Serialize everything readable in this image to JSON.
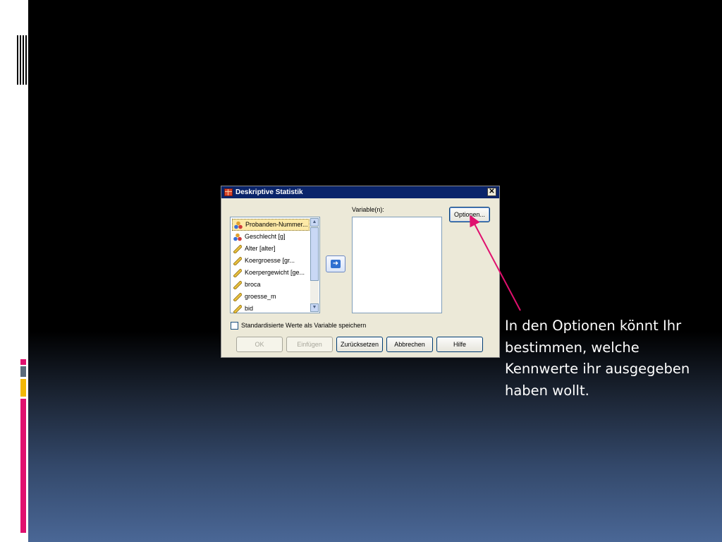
{
  "dialog": {
    "title": "Deskriptive Statistik",
    "close_label": "✕",
    "source_variables": [
      {
        "label": "Probanden-Nummer...",
        "icon": "nominal-variable-icon",
        "selected": true
      },
      {
        "label": "Geschlecht [g]",
        "icon": "nominal-variable-icon",
        "selected": false
      },
      {
        "label": "Alter [alter]",
        "icon": "scale-variable-icon",
        "selected": false
      },
      {
        "label": "Koergroesse [gr...",
        "icon": "scale-variable-icon",
        "selected": false
      },
      {
        "label": "Koerpergewicht [ge...",
        "icon": "scale-variable-icon",
        "selected": false
      },
      {
        "label": "broca",
        "icon": "scale-variable-icon",
        "selected": false
      },
      {
        "label": "groesse_m",
        "icon": "scale-variable-icon",
        "selected": false
      },
      {
        "label": "bid",
        "icon": "scale-variable-icon",
        "selected": false
      }
    ],
    "target_label": "Variable(n):",
    "options_button": "Optionen...",
    "checkbox_label": "Standardisierte Werte als Variable speichern",
    "checkbox_checked": false,
    "buttons": {
      "ok": "OK",
      "paste": "Einfügen",
      "reset": "Zurücksetzen",
      "cancel": "Abbrechen",
      "help": "Hilfe"
    }
  },
  "caption": "In den Optionen könnt Ihr bestimmen, welche Kennwerte ihr ausgegeben haben wollt.",
  "colors": {
    "arrow": "#e0106e",
    "accent_pink": "#e0106e",
    "accent_gray": "#5a6a7a",
    "accent_yellow": "#f2b705",
    "titlebar": "#0a246a"
  }
}
